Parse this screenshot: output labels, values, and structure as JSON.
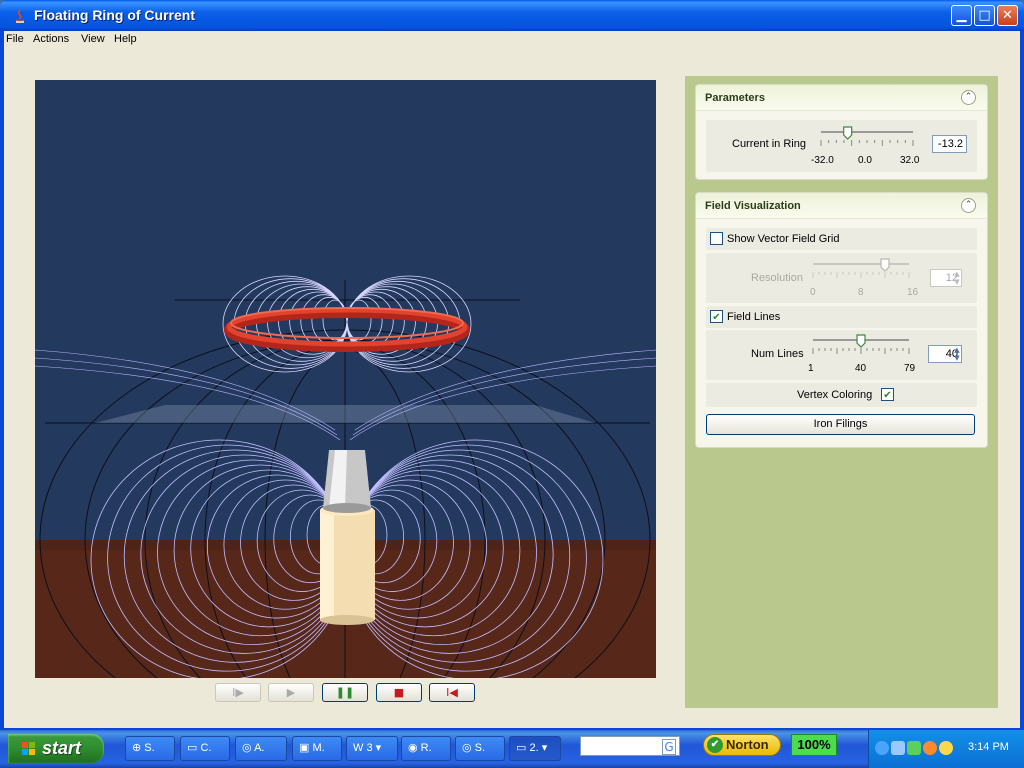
{
  "window": {
    "title": "Floating Ring of Current",
    "min_icon": "minimize-icon",
    "max_icon": "maximize-icon",
    "close_icon": "close-icon"
  },
  "menu": [
    "File",
    "Actions",
    "View",
    "Help"
  ],
  "playback": {
    "buttons": [
      {
        "name": "step-forward",
        "symbol": "I▶",
        "enabled": false
      },
      {
        "name": "play",
        "symbol": "▶",
        "enabled": false
      },
      {
        "name": "pause",
        "symbol": "❚❚",
        "enabled": true
      },
      {
        "name": "stop",
        "symbol": "■",
        "enabled": true
      },
      {
        "name": "reset",
        "symbol": "I◀",
        "enabled": true
      }
    ]
  },
  "parameters": {
    "title": "Parameters",
    "current_label": "Current in Ring",
    "current_value": "-13.2",
    "current_fraction": 0.29,
    "ticks": [
      "-32.0",
      "0.0",
      "32.0"
    ]
  },
  "field_viz": {
    "title": "Field Visualization",
    "show_grid_label": "Show Vector Field Grid",
    "show_grid_checked": false,
    "resolution_label": "Resolution",
    "resolution_value": "12",
    "resolution_fraction": 0.75,
    "resolution_ticks": [
      "0",
      "8",
      "16"
    ],
    "field_lines_label": "Field Lines",
    "field_lines_checked": true,
    "num_lines_label": "Num Lines",
    "num_lines_value": "40",
    "num_lines_fraction": 0.5,
    "num_lines_ticks": [
      "1",
      "40",
      "79"
    ],
    "vertex_coloring_label": "Vertex Coloring",
    "vertex_coloring_checked": true,
    "iron_filings_label": "Iron Filings"
  },
  "colors": {
    "viewport_bg": "#233a5e",
    "ring": "#e23b2b",
    "field_lines": "#c9c6ff",
    "panel_bg": "#b9c98d"
  },
  "taskbar": {
    "start_label": "start",
    "tasks": [
      {
        "label": "S.",
        "icon": "globe-icon"
      },
      {
        "label": "C.",
        "icon": "folder-icon"
      },
      {
        "label": "A.",
        "icon": "app-icon"
      },
      {
        "label": "M.",
        "icon": "powerpoint-icon"
      },
      {
        "label": "3",
        "icon": "word-icon"
      },
      {
        "label": "R.",
        "icon": "viewer-icon"
      },
      {
        "label": "S.",
        "icon": "app-icon"
      },
      {
        "label": "2.",
        "icon": "window-icon"
      }
    ],
    "norton_label": "Norton",
    "percent": "100%",
    "clock": "3:14 PM"
  }
}
